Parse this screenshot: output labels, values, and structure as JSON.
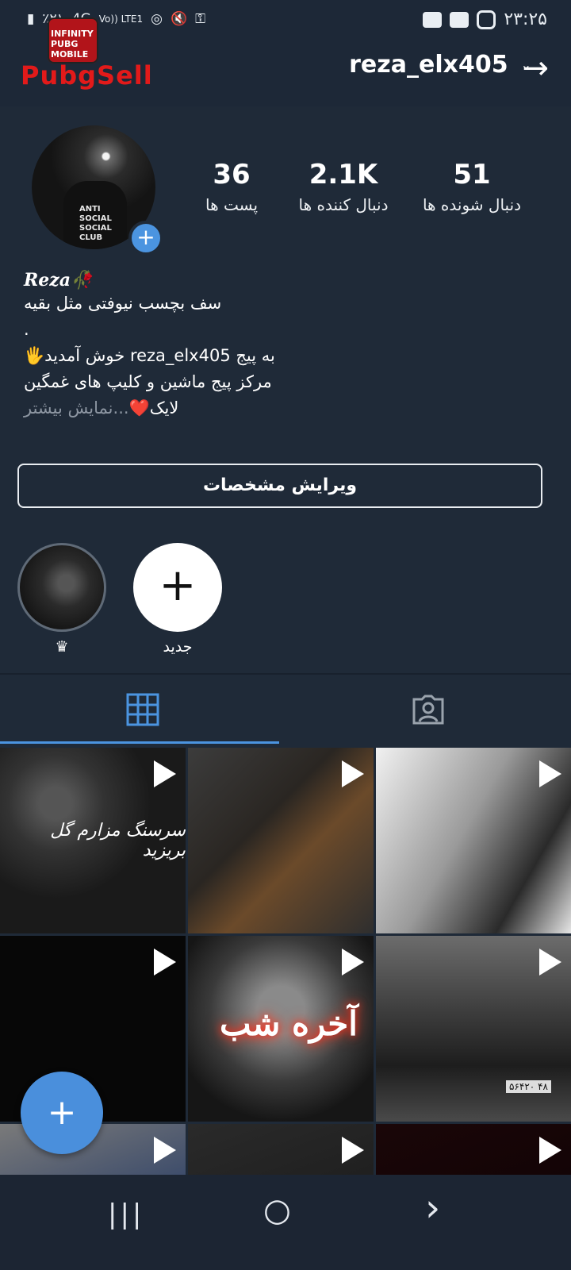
{
  "status_bar": {
    "time": "۲۳:۲۵",
    "battery_text": "٪۲۱",
    "network": "4G",
    "volte": "Vo)) LTE1"
  },
  "header": {
    "logo_badge_text": "INFINITY PUBG MOBILE",
    "logo_text": "PubgSell",
    "username": "reza_elx405",
    "dropdown_icon": "chevron-down-icon",
    "forward_icon": "arrow-right-icon"
  },
  "profile": {
    "stats": [
      {
        "value": "51",
        "label": "دنبال شونده ها"
      },
      {
        "value": "2.1K",
        "label": "دنبال کننده ها"
      },
      {
        "value": "36",
        "label": "پست ها"
      }
    ],
    "display_name": "Reza🥀",
    "bio_lines": [
      "سف بچسب  نیوفتی مثل بقیه",
      ".",
      "به پیج reza_elx405 خوش آمدید🖐",
      "مرکز پیج ماشین و کلیپ های غمگین",
      "لایک❤️"
    ],
    "more_text": "...نمایش بیشتر",
    "edit_button": "ویرایش مشخصات"
  },
  "highlights": [
    {
      "label": "♛",
      "type": "story"
    },
    {
      "label": "جدید",
      "type": "new"
    }
  ],
  "tabs": {
    "grid_icon": "grid-icon",
    "tagged_icon": "tagged-person-icon"
  },
  "grid": {
    "overlay_1": "سرسنگ مزارم گل بریزید",
    "overlay_5": "آخره شب",
    "overlay_6": "۴۸ ۵۶۴۲۰"
  },
  "fab_label": "+",
  "nav": {
    "recents": "|||",
    "home": "○",
    "back": "›"
  },
  "colors": {
    "background": "#1f2a38",
    "accent": "#4b94e0",
    "text": "#ffffff"
  }
}
